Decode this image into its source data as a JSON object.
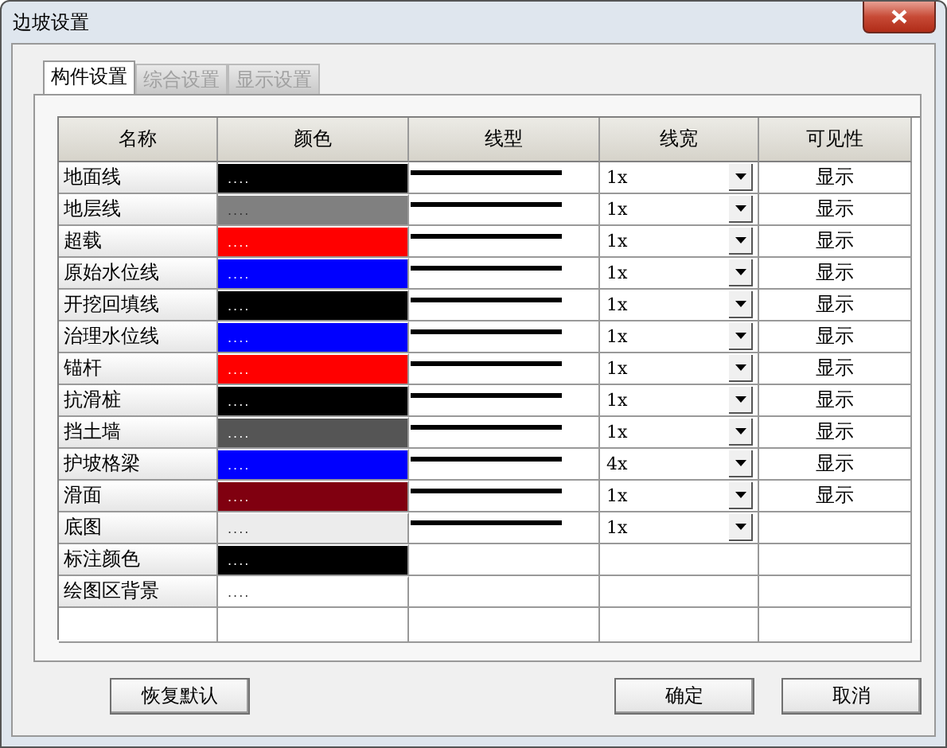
{
  "window": {
    "title": "边坡设置"
  },
  "tabs": [
    {
      "label": "构件设置",
      "selected": true,
      "disabled": false
    },
    {
      "label": "综合设置",
      "selected": false,
      "disabled": true
    },
    {
      "label": "显示设置",
      "selected": false,
      "disabled": true
    }
  ],
  "table": {
    "columns": [
      "名称",
      "颜色",
      "线型",
      "线宽",
      "可见性"
    ],
    "rows": [
      {
        "name": "地面线",
        "color": "#000000",
        "swatch": "....",
        "line_sample": true,
        "width": "1x",
        "visibility": "显示"
      },
      {
        "name": "地层线",
        "color": "#808080",
        "swatch": "....",
        "line_sample": true,
        "width": "1x",
        "visibility": "显示"
      },
      {
        "name": "超载",
        "color": "#ff0000",
        "swatch": "....",
        "line_sample": true,
        "width": "1x",
        "visibility": "显示"
      },
      {
        "name": "原始水位线",
        "color": "#0000ff",
        "swatch": "....",
        "line_sample": true,
        "width": "1x",
        "visibility": "显示"
      },
      {
        "name": "开挖回填线",
        "color": "#000000",
        "swatch": "....",
        "line_sample": true,
        "width": "1x",
        "visibility": "显示"
      },
      {
        "name": "治理水位线",
        "color": "#0000ff",
        "swatch": "....",
        "line_sample": true,
        "width": "1x",
        "visibility": "显示"
      },
      {
        "name": "锚杆",
        "color": "#ff0000",
        "swatch": "....",
        "line_sample": true,
        "width": "1x",
        "visibility": "显示"
      },
      {
        "name": "抗滑桩",
        "color": "#000000",
        "swatch": "....",
        "line_sample": true,
        "width": "1x",
        "visibility": "显示"
      },
      {
        "name": "挡土墙",
        "color": "#555555",
        "swatch": "....",
        "line_sample": true,
        "width": "1x",
        "visibility": "显示"
      },
      {
        "name": "护坡格梁",
        "color": "#0000ff",
        "swatch": "....",
        "line_sample": true,
        "width": "4x",
        "visibility": "显示"
      },
      {
        "name": "滑面",
        "color": "#800010",
        "swatch": "....",
        "line_sample": true,
        "width": "1x",
        "visibility": "显示"
      },
      {
        "name": "底图",
        "color": "#ececec",
        "swatch": "....",
        "line_sample": true,
        "width": "1x"
      },
      {
        "name": "标注颜色",
        "color": "#000000",
        "swatch": "....",
        "line_sample": false
      },
      {
        "name": "绘图区背景",
        "color": "#ffffff",
        "swatch": "....",
        "line_sample": false
      }
    ]
  },
  "buttons": [
    {
      "label": "恢复默认",
      "kind": "reset"
    },
    {
      "label": "确定",
      "kind": "ok"
    },
    {
      "label": "取消",
      "kind": "cancel"
    }
  ]
}
